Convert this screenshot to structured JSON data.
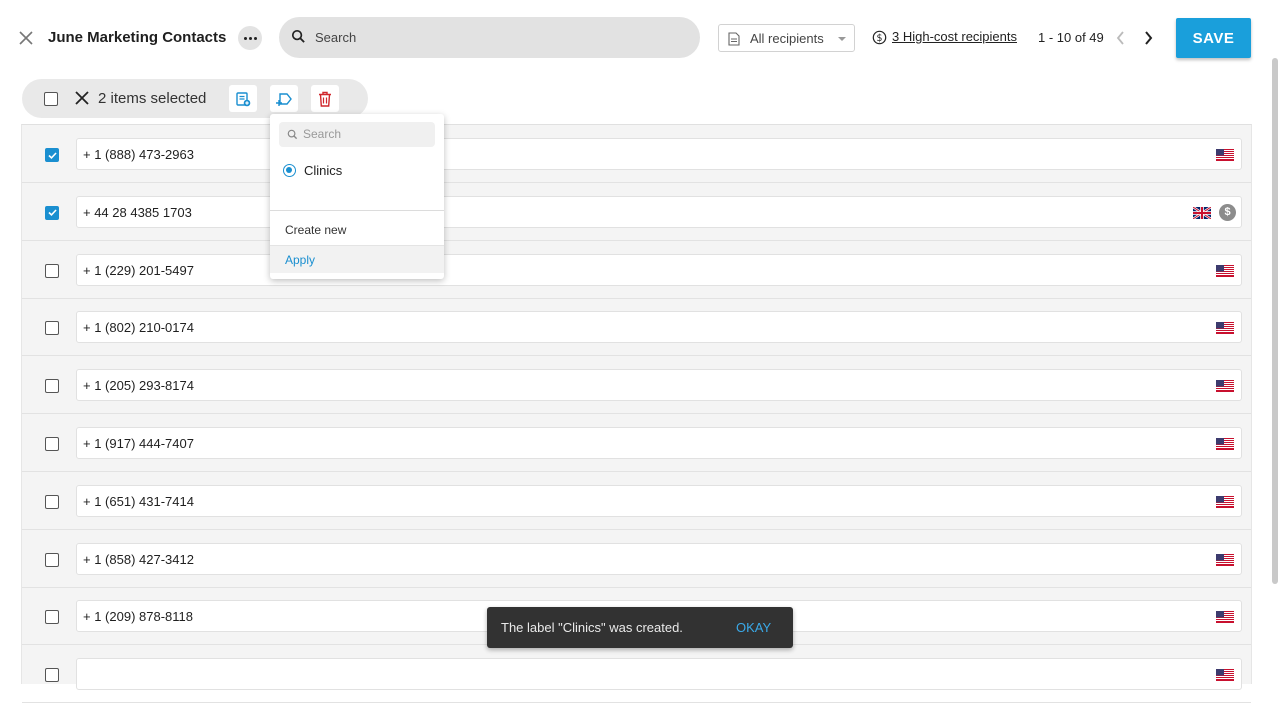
{
  "header": {
    "title": "June Marketing Contacts",
    "search_placeholder": "Search",
    "recipients_filter": "All recipients",
    "high_cost_link": "3 High-cost recipients",
    "pagination": "1 - 10 of 49",
    "save_label": "SAVE"
  },
  "selection": {
    "count_label": "2 items selected"
  },
  "dropdown": {
    "search_placeholder": "Search",
    "options": [
      {
        "label": "Clinics",
        "selected": true
      }
    ],
    "create_label": "Create new",
    "apply_label": "Apply"
  },
  "rows": [
    {
      "phone": "+ 1 (888) 473-2963",
      "checked": true,
      "flag": "us",
      "high_cost": false
    },
    {
      "phone": "+ 44 28 4385 1703",
      "checked": true,
      "flag": "uk",
      "high_cost": true
    },
    {
      "phone": "+ 1 (229) 201-5497",
      "checked": false,
      "flag": "us",
      "high_cost": false
    },
    {
      "phone": "+ 1 (802) 210-0174",
      "checked": false,
      "flag": "us",
      "high_cost": false
    },
    {
      "phone": "+ 1 (205) 293-8174",
      "checked": false,
      "flag": "us",
      "high_cost": false
    },
    {
      "phone": "+ 1 (917) 444-7407",
      "checked": false,
      "flag": "us",
      "high_cost": false
    },
    {
      "phone": "+ 1 (651) 431-7414",
      "checked": false,
      "flag": "us",
      "high_cost": false
    },
    {
      "phone": "+ 1 (858) 427-3412",
      "checked": false,
      "flag": "us",
      "high_cost": false
    },
    {
      "phone": "+ 1 (209) 878-8118",
      "checked": false,
      "flag": "us",
      "high_cost": false
    },
    {
      "phone": "",
      "checked": false,
      "flag": "us",
      "high_cost": false
    }
  ],
  "toast": {
    "message": "The label \"Clinics\" was created.",
    "action": "OKAY"
  },
  "colors": {
    "accent": "#1a9fdb",
    "checkbox_checked": "#1a8fd0",
    "delete_red": "#d0262c",
    "toast_bg": "#323232",
    "toast_action": "#3aa9e8"
  }
}
